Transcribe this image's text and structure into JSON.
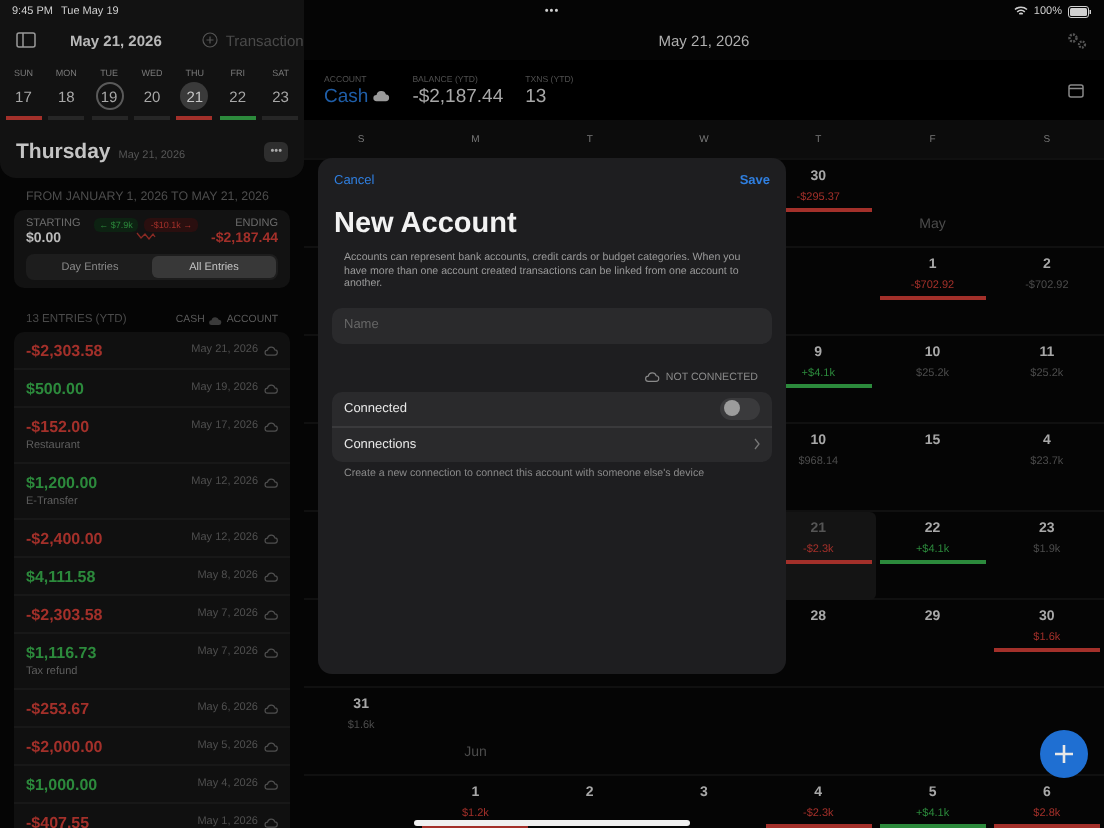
{
  "status_bar": {
    "time": "9:45 PM",
    "date": "Tue May 19",
    "dots": "•••",
    "battery": "100%"
  },
  "sidebar": {
    "header": {
      "date": "May 21, 2026",
      "action": "Transaction"
    },
    "week": [
      {
        "name": "SUN",
        "day": "17",
        "color": "#a3302a",
        "today": false,
        "selected": false
      },
      {
        "name": "MON",
        "day": "18",
        "color": "#262626",
        "today": false,
        "selected": false
      },
      {
        "name": "TUE",
        "day": "19",
        "color": "#262626",
        "today": true,
        "selected": false
      },
      {
        "name": "WED",
        "day": "20",
        "color": "#262626",
        "today": false,
        "selected": false
      },
      {
        "name": "THU",
        "day": "21",
        "color": "#a3302a",
        "today": false,
        "selected": true
      },
      {
        "name": "FRI",
        "day": "22",
        "color": "#2c8a3c",
        "today": false,
        "selected": false
      },
      {
        "name": "SAT",
        "day": "23",
        "color": "#262626",
        "today": false,
        "selected": false
      }
    ],
    "day_title": {
      "weekday": "Thursday",
      "date": "May 21, 2026",
      "more": "•••"
    },
    "range": "FROM JANUARY 1, 2026 TO MAY 21, 2026",
    "summary": {
      "starting_label": "STARTING",
      "starting": "$0.00",
      "inflow": "← $7.9k",
      "outflow": "-$10.1k →",
      "ending_label": "ENDING",
      "ending": "-$2,187.44"
    },
    "segments": [
      {
        "label": "Day Entries",
        "selected": false
      },
      {
        "label": "All Entries",
        "selected": true
      }
    ],
    "entries_header": {
      "count": "13 ENTRIES (YTD)",
      "account_prefix": "CASH",
      "account_suffix": "ACCOUNT"
    },
    "entries": [
      {
        "amount": "-$2,303.58",
        "date": "May 21, 2026",
        "kind": "expense"
      },
      {
        "amount": "$500.00",
        "date": "May 19, 2026",
        "kind": "income"
      },
      {
        "amount": "-$152.00",
        "date": "May 17, 2026",
        "note": "Restaurant",
        "kind": "expense"
      },
      {
        "amount": "$1,200.00",
        "date": "May 12, 2026",
        "note": "E-Transfer",
        "kind": "income"
      },
      {
        "amount": "-$2,400.00",
        "date": "May 12, 2026",
        "kind": "expense"
      },
      {
        "amount": "$4,111.58",
        "date": "May 8, 2026",
        "kind": "income"
      },
      {
        "amount": "-$2,303.58",
        "date": "May 7, 2026",
        "kind": "expense"
      },
      {
        "amount": "$1,116.73",
        "date": "May 7, 2026",
        "note": "Tax refund",
        "kind": "income"
      },
      {
        "amount": "-$253.67",
        "date": "May 6, 2026",
        "kind": "expense"
      },
      {
        "amount": "-$2,000.00",
        "date": "May 5, 2026",
        "kind": "expense"
      },
      {
        "amount": "$1,000.00",
        "date": "May 4, 2026",
        "kind": "income"
      },
      {
        "amount": "-$407.55",
        "date": "May 1, 2026",
        "kind": "expense"
      }
    ]
  },
  "main": {
    "header": {
      "date": "May 21, 2026"
    },
    "account_bar": {
      "account_label": "ACCOUNT",
      "account": "Cash",
      "balance_label": "BALANCE (YTD)",
      "balance": "-$2,187.44",
      "txns_label": "TXNS (YTD)",
      "txns": "13"
    },
    "calendar": {
      "weekdays": [
        "S",
        "M",
        "T",
        "W",
        "T",
        "F",
        "S"
      ],
      "weeks": [
        [
          {
            "kind": "blank"
          },
          {
            "kind": "blank"
          },
          {
            "kind": "blank"
          },
          {
            "kind": "blank"
          },
          {
            "kind": "day",
            "day": "30",
            "amount": "-$295.37",
            "color": "#a3302a",
            "selected": false
          },
          {
            "kind": "month",
            "month": "May"
          },
          {
            "kind": "blank"
          }
        ],
        [
          {
            "kind": "blank"
          },
          {
            "kind": "blank"
          },
          {
            "kind": "blank"
          },
          {
            "kind": "blank"
          },
          {
            "kind": "blank"
          },
          {
            "kind": "day",
            "day": "1",
            "amount": "-$702.92",
            "color": "#a3302a",
            "selected": false
          },
          {
            "kind": "day",
            "day": "2",
            "amount": "-$702.92",
            "selected": false
          }
        ],
        [
          {
            "kind": "blank"
          },
          {
            "kind": "blank"
          },
          {
            "kind": "blank"
          },
          {
            "kind": "blank"
          },
          {
            "kind": "day",
            "day": "9",
            "amount": "+$4.1k",
            "color": "#2c8a3c",
            "selected": false
          },
          {
            "kind": "day",
            "day": "10",
            "amount": "$25.2k",
            "selected": false
          },
          {
            "kind": "day",
            "day": "11",
            "amount": "$25.2k",
            "selected": false
          }
        ],
        [
          {
            "kind": "blank"
          },
          {
            "kind": "blank"
          },
          {
            "kind": "blank"
          },
          {
            "kind": "blank"
          },
          {
            "kind": "day",
            "day": "10",
            "amount": "$968.14",
            "selected": false
          },
          {
            "kind": "day",
            "day": "15",
            "selected": false
          },
          {
            "kind": "day",
            "day": "4",
            "amount": "$23.7k",
            "selected": false
          }
        ],
        [
          {
            "kind": "blank"
          },
          {
            "kind": "blank"
          },
          {
            "kind": "blank"
          },
          {
            "kind": "blank"
          },
          {
            "kind": "day",
            "day": "21",
            "amount": "-$2.3k",
            "color": "#a3302a",
            "selected": true
          },
          {
            "kind": "day",
            "day": "22",
            "amount": "+$4.1k",
            "color": "#2c8a3c",
            "selected": false
          },
          {
            "kind": "day",
            "day": "23",
            "amount": "$1.9k",
            "selected": false
          }
        ],
        [
          {
            "kind": "blank"
          },
          {
            "kind": "blank"
          },
          {
            "kind": "blank"
          },
          {
            "kind": "blank"
          },
          {
            "kind": "day",
            "day": "28",
            "selected": false
          },
          {
            "kind": "day",
            "day": "29",
            "selected": false
          },
          {
            "kind": "day",
            "day": "30",
            "amount": "$1.6k",
            "color": "#a3302a",
            "selected": false
          }
        ],
        [
          {
            "kind": "day",
            "day": "31",
            "amount": "$1.6k",
            "selected": false
          },
          {
            "kind": "month",
            "month": "Jun"
          },
          {
            "kind": "blank"
          },
          {
            "kind": "blank"
          },
          {
            "kind": "blank"
          },
          {
            "kind": "blank"
          },
          {
            "kind": "blank"
          }
        ],
        [
          {
            "kind": "blank"
          },
          {
            "kind": "day",
            "day": "1",
            "amount": "$1.2k",
            "color": "#a3302a",
            "selected": false
          },
          {
            "kind": "day",
            "day": "2",
            "selected": false
          },
          {
            "kind": "day",
            "day": "3",
            "selected": false
          },
          {
            "kind": "day",
            "day": "4",
            "amount": "-$2.3k",
            "color": "#a3302a",
            "selected": false
          },
          {
            "kind": "day",
            "day": "5",
            "amount": "+$4.1k",
            "color": "#2c8a3c",
            "selected": false
          },
          {
            "kind": "day",
            "day": "6",
            "amount": "$2.8k",
            "color": "#a3302a",
            "selected": false
          }
        ]
      ]
    }
  },
  "modal": {
    "cancel": "Cancel",
    "save": "Save",
    "title": "New Account",
    "description": "Accounts can represent bank accounts, credit cards or budget categories. When you have more than one account created transactions can be linked from one account to another.",
    "name_placeholder": "Name",
    "connection_status": "NOT CONNECTED",
    "rows": [
      {
        "kind": "toggle",
        "label": "Connected",
        "on": false
      },
      {
        "kind": "link",
        "label": "Connections"
      }
    ],
    "footnote": "Create a new connection to connect this account with someone else's device"
  }
}
